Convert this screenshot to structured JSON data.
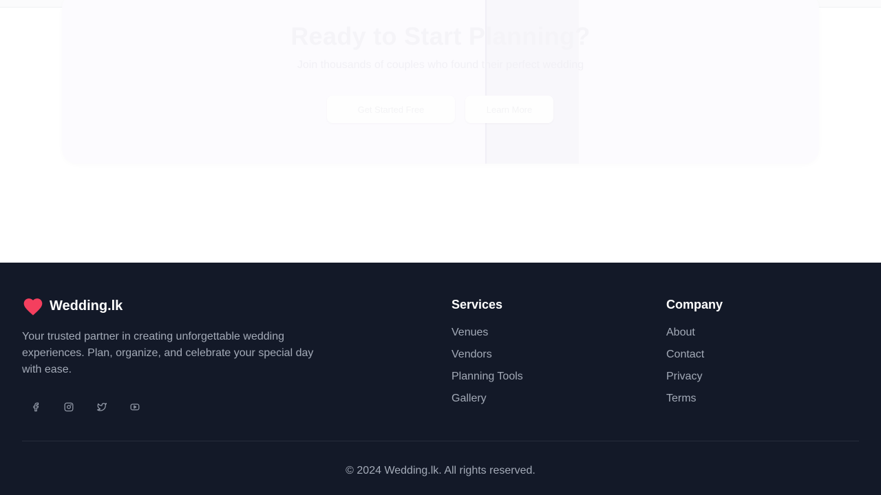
{
  "cta": {
    "title": "Ready to Start Planning?",
    "subtitle": "Join thousands of couples who found their perfect wedding",
    "primary_button": "Get Started Free",
    "secondary_button": "Learn More"
  },
  "footer": {
    "brand_name": "Wedding.lk",
    "tagline": "Your trusted partner in creating unforgettable wedding experiences. Plan, organize, and celebrate your special day with ease.",
    "social": [
      "facebook-icon",
      "instagram-icon",
      "twitter-icon",
      "youtube-icon"
    ],
    "services": {
      "heading": "Services",
      "links": [
        "Venues",
        "Vendors",
        "Planning Tools",
        "Gallery"
      ]
    },
    "company": {
      "heading": "Company",
      "links": [
        "About",
        "Contact",
        "Privacy",
        "Terms"
      ]
    },
    "copyright": "© 2024 Wedding.lk. All rights reserved."
  },
  "colors": {
    "footer_bg": "#131928",
    "brand_accent": "#f43f5e",
    "muted_text": "#a3aab7"
  }
}
